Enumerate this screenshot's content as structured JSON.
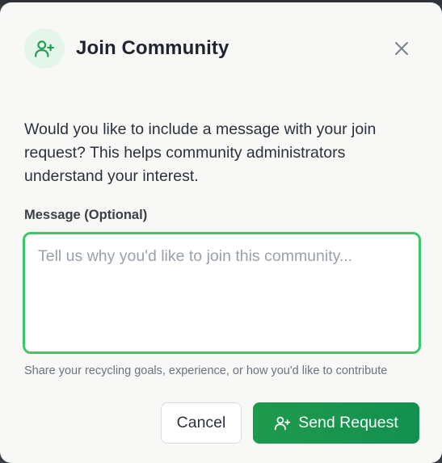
{
  "dialog": {
    "title": "Join Community",
    "header_icon": "user-plus-icon",
    "close_icon": "close-icon",
    "description": "Would you like to include a message with your join request? This helps community administrators understand your interest.",
    "message_label": "Message (Optional)",
    "message_placeholder": "Tell us why you'd like to join this community...",
    "message_value": "",
    "helper_text": "Share your recycling goals, experience, or how you'd like to contribute",
    "cancel_label": "Cancel",
    "send_label": "Send Request",
    "send_icon": "user-plus-icon"
  },
  "colors": {
    "accent": "#1e9a4e",
    "focus_border": "#3cc86a",
    "icon_bg": "#e4f6ea"
  }
}
